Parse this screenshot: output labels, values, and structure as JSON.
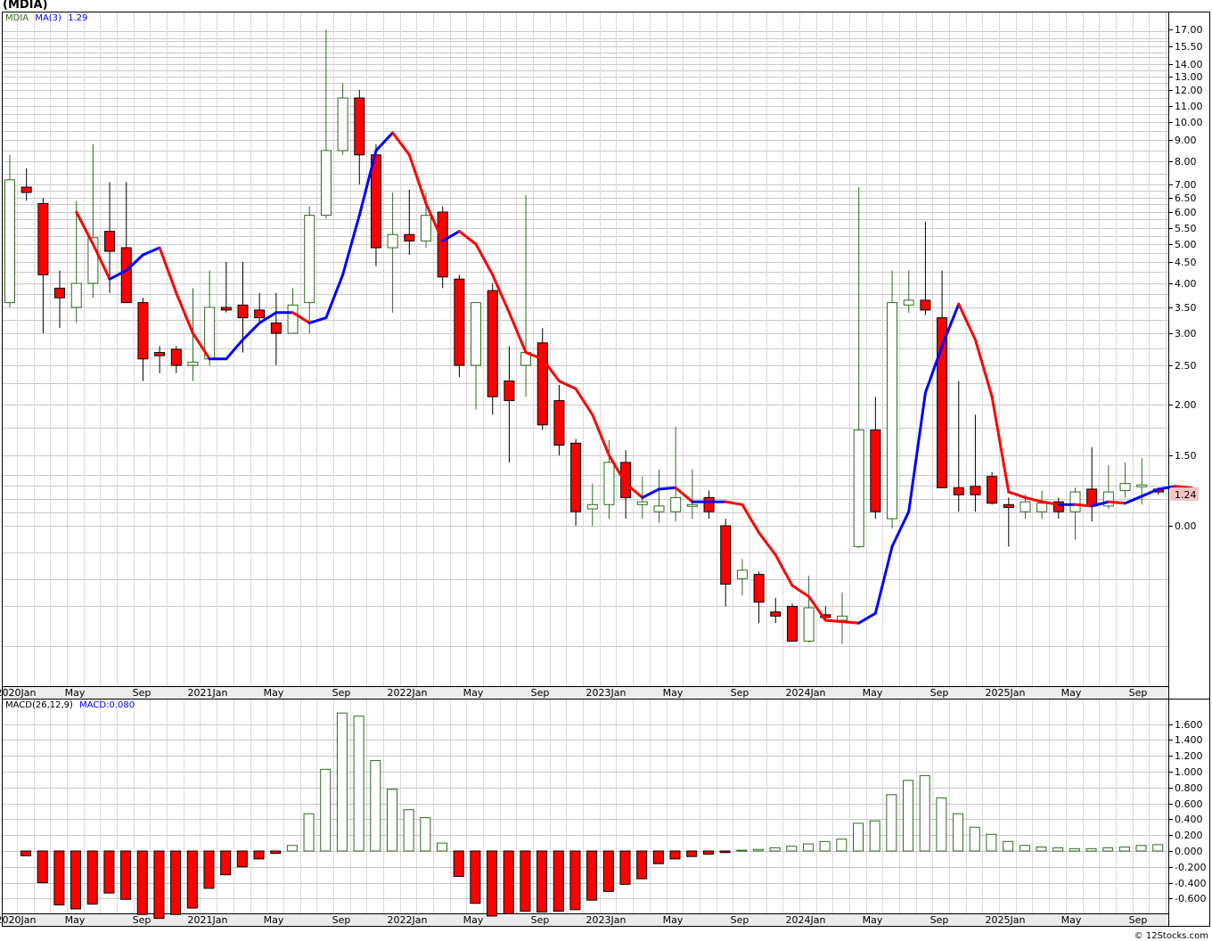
{
  "title": "(MDIA)",
  "legend": {
    "symbol": "MDIA",
    "ma_label": "MA(3)",
    "ma_value": "1.29",
    "macd_label": "MACD(26,12,9)",
    "macd_value": "MACD:0.080"
  },
  "last_price_tag": "1.24",
  "credit": "© 12Stocks.com",
  "colors": {
    "up_outline": "#2e6b1f",
    "down_fill": "#ff0000",
    "ma_down": "#ff0000",
    "ma_up": "#0000ff",
    "grid": "#c8c8c8",
    "price_tag_bg": "#f4c4c4"
  },
  "chart_data": [
    {
      "type": "candlestick",
      "name": "price",
      "y_axis_ticks": [
        "0.00",
        "1.50",
        "2.00",
        "2.50",
        "3.00",
        "3.50",
        "4.00",
        "4.50",
        "5.00",
        "5.50",
        "6.00",
        "6.50",
        "7.00",
        "8.00",
        "9.00",
        "10.00",
        "11.00",
        "12.00",
        "13.00",
        "14.00",
        "15.50",
        "17.00"
      ],
      "x_axis_ticks": [
        "2020Jan",
        "May",
        "Sep",
        "2021Jan",
        "May",
        "Sep",
        "2022Jan",
        "May",
        "Sep",
        "2023Jan",
        "May",
        "Sep",
        "2024Jan",
        "May",
        "Sep",
        "2025Jan",
        "May",
        "Sep"
      ],
      "candles": [
        {
          "o": 3.6,
          "h": 8.3,
          "l": 3.5,
          "c": 7.2
        },
        {
          "o": 6.9,
          "h": 7.7,
          "l": 6.4,
          "c": 6.7
        },
        {
          "o": 6.3,
          "h": 6.5,
          "l": 3.0,
          "c": 4.2
        },
        {
          "o": 3.9,
          "h": 4.3,
          "l": 3.1,
          "c": 3.7
        },
        {
          "o": 3.5,
          "h": 6.4,
          "l": 3.2,
          "c": 4.0
        },
        {
          "o": 4.0,
          "h": 8.8,
          "l": 3.7,
          "c": 5.2
        },
        {
          "o": 5.4,
          "h": 7.1,
          "l": 3.8,
          "c": 4.8
        },
        {
          "o": 4.9,
          "h": 7.1,
          "l": 3.8,
          "c": 3.6
        },
        {
          "o": 3.6,
          "h": 3.7,
          "l": 2.3,
          "c": 2.6
        },
        {
          "o": 2.7,
          "h": 2.8,
          "l": 2.4,
          "c": 2.65
        },
        {
          "o": 2.75,
          "h": 2.8,
          "l": 2.4,
          "c": 2.5
        },
        {
          "o": 2.5,
          "h": 3.9,
          "l": 2.3,
          "c": 2.55
        },
        {
          "o": 2.6,
          "h": 4.3,
          "l": 2.5,
          "c": 3.5
        },
        {
          "o": 3.5,
          "h": 4.5,
          "l": 3.4,
          "c": 3.45
        },
        {
          "o": 3.55,
          "h": 4.5,
          "l": 2.7,
          "c": 3.3
        },
        {
          "o": 3.45,
          "h": 3.8,
          "l": 3.2,
          "c": 3.3
        },
        {
          "o": 3.2,
          "h": 3.8,
          "l": 2.5,
          "c": 3.0
        },
        {
          "o": 3.0,
          "h": 3.9,
          "l": 3.0,
          "c": 3.55
        },
        {
          "o": 3.6,
          "h": 6.2,
          "l": 3.0,
          "c": 5.9
        },
        {
          "o": 5.9,
          "h": 17.0,
          "l": 5.8,
          "c": 8.5
        },
        {
          "o": 8.5,
          "h": 12.5,
          "l": 8.3,
          "c": 11.5
        },
        {
          "o": 11.5,
          "h": 12.0,
          "l": 7.0,
          "c": 8.3
        },
        {
          "o": 8.3,
          "h": 8.8,
          "l": 4.4,
          "c": 4.9
        },
        {
          "o": 4.9,
          "h": 6.7,
          "l": 3.4,
          "c": 5.3
        },
        {
          "o": 5.3,
          "h": 6.8,
          "l": 4.7,
          "c": 5.1
        },
        {
          "o": 5.1,
          "h": 6.7,
          "l": 4.9,
          "c": 5.9
        },
        {
          "o": 6.0,
          "h": 6.2,
          "l": 3.9,
          "c": 4.15
        },
        {
          "o": 4.1,
          "h": 4.2,
          "l": 2.35,
          "c": 2.5
        },
        {
          "o": 2.5,
          "h": 3.6,
          "l": 1.95,
          "c": 3.6
        },
        {
          "o": 3.85,
          "h": 4.0,
          "l": 1.9,
          "c": 2.1
        },
        {
          "o": 2.3,
          "h": 2.8,
          "l": 1.45,
          "c": 2.05
        },
        {
          "o": 2.5,
          "h": 6.6,
          "l": 2.1,
          "c": 2.7
        },
        {
          "o": 2.85,
          "h": 3.1,
          "l": 1.75,
          "c": 1.8
        },
        {
          "o": 2.05,
          "h": 2.25,
          "l": 1.5,
          "c": 1.6
        },
        {
          "o": 1.62,
          "h": 1.66,
          "l": 1.0,
          "c": 1.1
        },
        {
          "o": 1.12,
          "h": 1.3,
          "l": 1.0,
          "c": 1.15
        },
        {
          "o": 1.15,
          "h": 1.65,
          "l": 1.05,
          "c": 1.45
        },
        {
          "o": 1.45,
          "h": 1.55,
          "l": 1.05,
          "c": 1.2
        },
        {
          "o": 1.15,
          "h": 1.35,
          "l": 1.05,
          "c": 1.17
        },
        {
          "o": 1.1,
          "h": 1.4,
          "l": 1.02,
          "c": 1.14
        },
        {
          "o": 1.1,
          "h": 1.78,
          "l": 1.03,
          "c": 1.2
        },
        {
          "o": 1.15,
          "h": 1.4,
          "l": 1.05,
          "c": 1.15
        },
        {
          "o": 1.2,
          "h": 1.25,
          "l": 1.05,
          "c": 1.1
        },
        {
          "o": 1.0,
          "h": 1.05,
          "l": 0.42,
          "c": 0.58
        },
        {
          "o": 0.62,
          "h": 0.76,
          "l": 0.5,
          "c": 0.68
        },
        {
          "o": 0.65,
          "h": 0.67,
          "l": 0.3,
          "c": 0.45
        },
        {
          "o": 0.38,
          "h": 0.48,
          "l": 0.3,
          "c": 0.35
        },
        {
          "o": 0.42,
          "h": 0.44,
          "l": 0.3,
          "c": 0.17
        },
        {
          "o": 0.17,
          "h": 0.64,
          "l": 0.16,
          "c": 0.41
        },
        {
          "o": 0.36,
          "h": 0.42,
          "l": 0.32,
          "c": 0.34
        },
        {
          "o": 0.32,
          "h": 0.52,
          "l": 0.15,
          "c": 0.35
        },
        {
          "o": 0.85,
          "h": 6.9,
          "l": 0.84,
          "c": 1.75
        },
        {
          "o": 1.75,
          "h": 2.1,
          "l": 1.05,
          "c": 1.1
        },
        {
          "o": 1.05,
          "h": 4.3,
          "l": 0.98,
          "c": 3.6
        },
        {
          "o": 3.55,
          "h": 4.3,
          "l": 3.4,
          "c": 3.65
        },
        {
          "o": 3.65,
          "h": 5.7,
          "l": 3.35,
          "c": 3.45
        },
        {
          "o": 3.3,
          "h": 4.3,
          "l": 1.95,
          "c": 1.27
        },
        {
          "o": 1.27,
          "h": 2.3,
          "l": 1.1,
          "c": 1.22
        },
        {
          "o": 1.28,
          "h": 1.9,
          "l": 1.1,
          "c": 1.22
        },
        {
          "o": 1.35,
          "h": 1.38,
          "l": 1.15,
          "c": 1.16
        },
        {
          "o": 1.15,
          "h": 1.2,
          "l": 0.85,
          "c": 1.13
        },
        {
          "o": 1.1,
          "h": 1.22,
          "l": 1.05,
          "c": 1.17
        },
        {
          "o": 1.1,
          "h": 1.25,
          "l": 1.05,
          "c": 1.16
        },
        {
          "o": 1.17,
          "h": 1.2,
          "l": 1.05,
          "c": 1.1
        },
        {
          "o": 1.1,
          "h": 1.27,
          "l": 0.9,
          "c": 1.24
        },
        {
          "o": 1.26,
          "h": 1.58,
          "l": 1.03,
          "c": 1.14
        },
        {
          "o": 1.14,
          "h": 1.43,
          "l": 1.12,
          "c": 1.24
        },
        {
          "o": 1.25,
          "h": 1.45,
          "l": 1.2,
          "c": 1.3
        },
        {
          "o": 1.28,
          "h": 1.48,
          "l": 1.15,
          "c": 1.29
        },
        {
          "o": 1.26,
          "h": 1.27,
          "l": 1.22,
          "c": 1.24
        }
      ],
      "ma3": [
        null,
        null,
        6.0,
        5.0,
        4.1,
        4.3,
        4.7,
        4.9,
        3.8,
        3.0,
        2.6,
        2.6,
        2.9,
        3.2,
        3.4,
        3.4,
        3.2,
        3.3,
        4.2,
        5.9,
        8.5,
        9.4,
        8.3,
        6.3,
        5.1,
        5.4,
        5.0,
        4.2,
        3.4,
        2.7,
        2.6,
        2.3,
        2.2,
        1.9,
        1.5,
        1.3,
        1.2,
        1.26,
        1.27,
        1.17,
        1.17,
        1.17,
        1.15,
        0.95,
        0.79,
        0.57,
        0.49,
        0.32,
        0.31,
        0.3,
        0.37,
        0.85,
        1.1,
        2.15,
        2.8,
        3.57,
        2.9,
        2.1,
        1.24,
        1.2,
        1.17,
        1.15,
        1.15,
        1.14,
        1.17,
        1.16,
        1.21,
        1.26,
        1.28,
        1.27
      ]
    },
    {
      "type": "bar",
      "name": "MACD(26,12,9)",
      "y_axis_ticks": [
        "-0.600",
        "-0.400",
        "-0.200",
        "0.000",
        "0.200",
        "0.400",
        "0.600",
        "0.800",
        "1.000",
        "1.200",
        "1.400",
        "1.600"
      ],
      "values": [
        -0.06,
        -0.4,
        -0.68,
        -0.73,
        -0.67,
        -0.53,
        -0.61,
        -0.8,
        -0.85,
        -0.8,
        -0.72,
        -0.47,
        -0.3,
        -0.2,
        -0.1,
        -0.03,
        0.07,
        0.47,
        1.03,
        1.74,
        1.7,
        1.14,
        0.78,
        0.52,
        0.42,
        0.1,
        -0.32,
        -0.66,
        -0.82,
        -0.79,
        -0.76,
        -0.77,
        -0.76,
        -0.74,
        -0.62,
        -0.51,
        -0.42,
        -0.35,
        -0.16,
        -0.1,
        -0.07,
        -0.04,
        -0.02,
        0.01,
        0.02,
        0.04,
        0.06,
        0.09,
        0.12,
        0.15,
        0.35,
        0.38,
        0.71,
        0.89,
        0.95,
        0.67,
        0.47,
        0.3,
        0.21,
        0.12,
        0.07,
        0.05,
        0.04,
        0.03,
        0.03,
        0.04,
        0.05,
        0.07,
        0.08,
        0.08
      ]
    }
  ]
}
